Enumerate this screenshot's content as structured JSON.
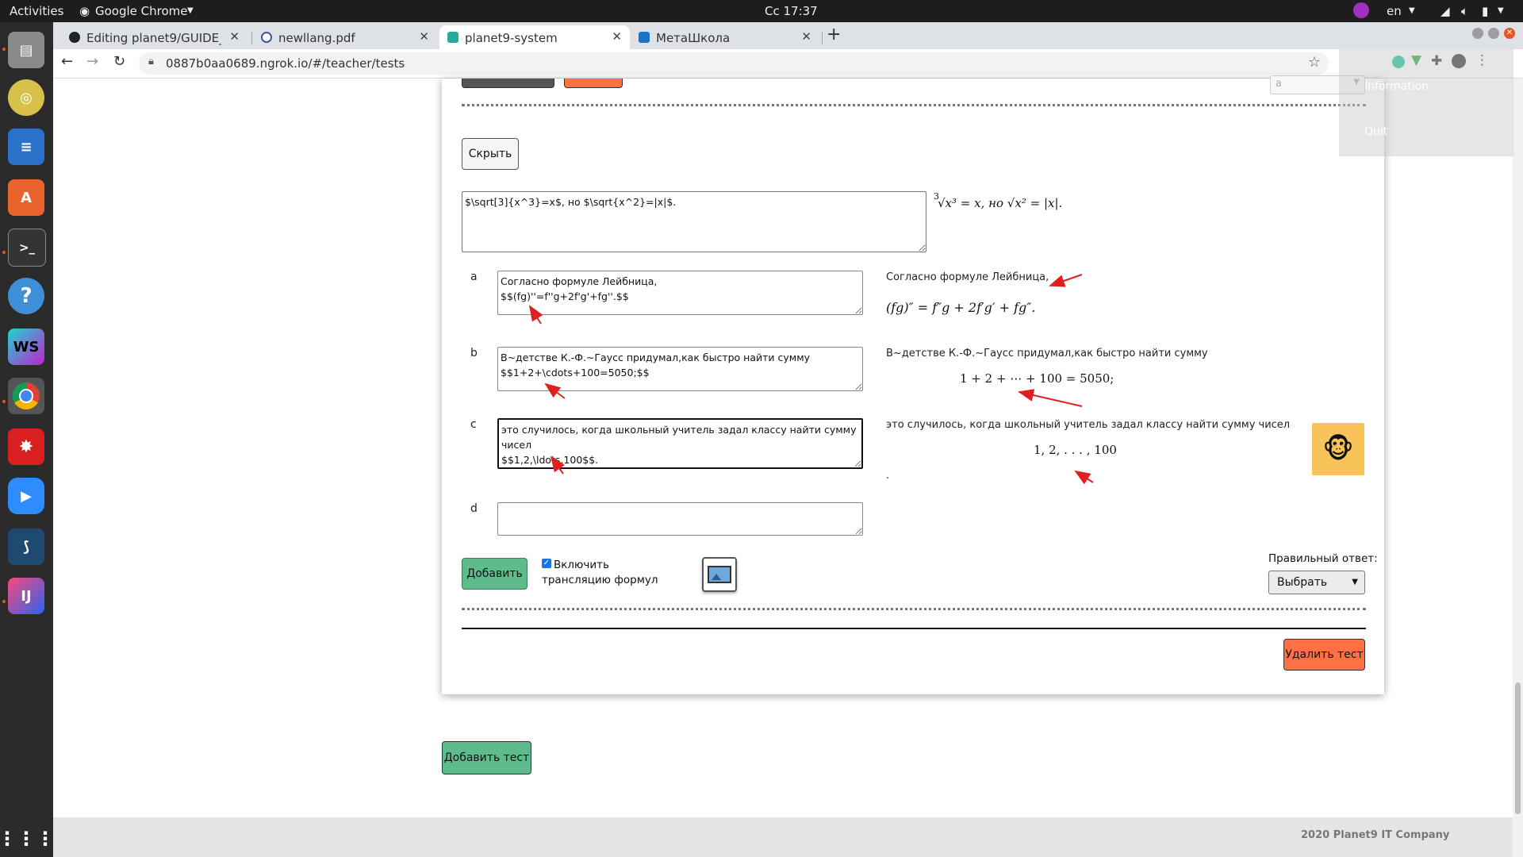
{
  "ubuntu": {
    "activities": "Activities",
    "app_name": "Google Chrome",
    "clock": "Сс 17:37",
    "language": "en"
  },
  "browser": {
    "tabs": [
      {
        "title": "Editing planet9/GUIDE_L",
        "favicon": "github-icon"
      },
      {
        "title": "newllang.pdf",
        "favicon": "pdf-globe-icon"
      },
      {
        "title": "planet9-system",
        "favicon": "planet9-icon"
      },
      {
        "title": "МетаШкола",
        "favicon": "metaschool-icon"
      }
    ],
    "active_tab_index": 2,
    "new_tab": "+",
    "url": "0887b0aa0689.ngrok.io/#/teacher/tests"
  },
  "overlay_menu": {
    "item1": "Information",
    "item2": "Quit"
  },
  "question": {
    "hide_button": "Скрыть",
    "text": "$\\sqrt[3]{x^3}=x$, но $\\sqrt{x^2}=|x|$.",
    "preview_prefix_root": "3",
    "preview": "√x³ = x, но √x² = |x|."
  },
  "answers": [
    {
      "letter": "a",
      "text": "Согласно формуле Лейбница,\n$$(fg)''=f''g+2f'g'+fg''.$$",
      "preview_text": "Согласно формуле Лейбница,",
      "preview_math": "(fg)″ = f″g + 2f′g′ + fg″."
    },
    {
      "letter": "b",
      "text": "В~детстве К.-Ф.~Гаусс придумал,как быстро найти сумму\n$$1+2+\\cdots+100=5050;$$",
      "preview_text": "В~детстве К.-Ф.~Гаусс придумал,как быстро найти сумму",
      "preview_math": "1 + 2 + ⋯ + 100 = 5050;"
    },
    {
      "letter": "c",
      "text": "это случилось, когда школьный учитель задал классу найти сумму чисел\n$$1,2,\\ldots,100$$.",
      "preview_text": "это случилось, когда школьный учитель задал классу найти сумму чисел",
      "preview_math": "1, 2, . . . , 100",
      "preview_tail": "."
    },
    {
      "letter": "d",
      "text": "",
      "preview_text": "",
      "preview_math": ""
    }
  ],
  "controls": {
    "add_button": "Добавить",
    "formula_checkbox_label": "Включить трансляцию формул",
    "formula_checkbox_checked": true,
    "correct_answer_label": "Правильный ответ:",
    "correct_answer_select": "Выбрать",
    "delete_test_button": "Удалить тест",
    "add_test_button": "Добавить тест",
    "top_select_value": "a"
  },
  "footer": {
    "copyright": "2020 Planet9 IT Company"
  },
  "colors": {
    "green_button": "#5dbb8c",
    "orange_button": "#ff7043",
    "annotation_arrow": "#e02020"
  }
}
